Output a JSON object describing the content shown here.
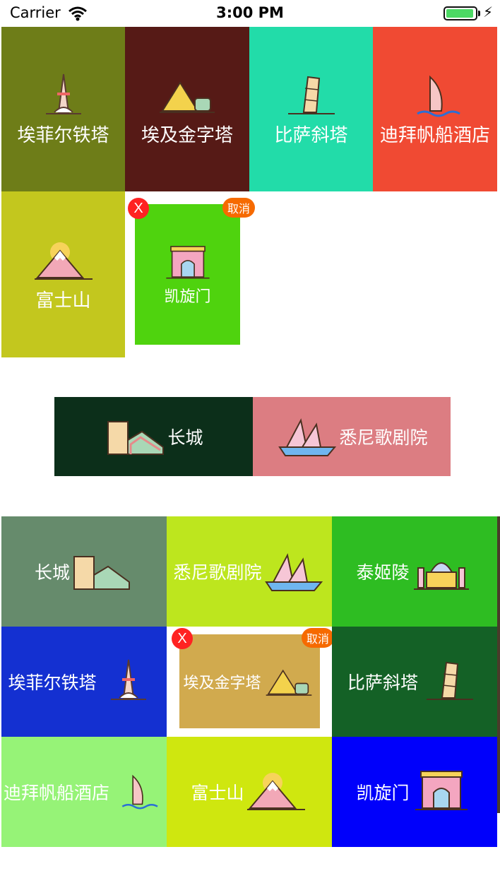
{
  "status_bar": {
    "carrier": "Carrier",
    "time": "3:00 PM",
    "bolt": "⚡"
  },
  "grid1": [
    {
      "label": "埃菲尔铁塔",
      "icon": "eiffel-tower-icon",
      "color": "#6e7d18"
    },
    {
      "label": "埃及金字塔",
      "icon": "pyramid-icon",
      "color": "#561a16"
    },
    {
      "label": "比萨斜塔",
      "icon": "pisa-tower-icon",
      "color": "#22dca9"
    },
    {
      "label": "迪拜帆船酒店",
      "icon": "burj-al-arab-icon",
      "color": "#f04a33"
    },
    {
      "label": "富士山",
      "icon": "mount-fuji-icon",
      "color": "#c3c71e"
    },
    {
      "label": "凯旋门",
      "icon": "arc-de-triomphe-icon",
      "color": "#4fd30e"
    }
  ],
  "edit_badges": {
    "delete": "X",
    "cancel": "取消"
  },
  "middle_row": [
    {
      "label": "长城",
      "icon": "great-wall-icon",
      "color": "#0c2f1a"
    },
    {
      "label": "悉尼歌剧院",
      "icon": "sydney-opera-house-icon",
      "color": "#dc7d82"
    }
  ],
  "grid2": [
    {
      "label": "长城",
      "icon": "great-wall-icon",
      "color": "#668b6c"
    },
    {
      "label": "悉尼歌剧院",
      "icon": "sydney-opera-house-icon",
      "color": "#bde61e"
    },
    {
      "label": "泰姬陵",
      "icon": "taj-mahal-icon",
      "color": "#2ebd22"
    },
    {
      "label": "埃菲尔铁塔",
      "icon": "eiffel-tower-icon",
      "color": "#1430d1"
    },
    {
      "label": "埃及金字塔",
      "icon": "pyramid-icon",
      "color": "#d1aa4e"
    },
    {
      "label": "比萨斜塔",
      "icon": "pisa-tower-icon",
      "color": "#146126"
    },
    {
      "label": "迪拜帆船酒店",
      "icon": "burj-al-arab-icon",
      "color": "#96f377"
    },
    {
      "label": "富士山",
      "icon": "mount-fuji-icon",
      "color": "#cfe70f"
    },
    {
      "label": "凯旋门",
      "icon": "arc-de-triomphe-icon",
      "color": "#0000fb"
    }
  ]
}
